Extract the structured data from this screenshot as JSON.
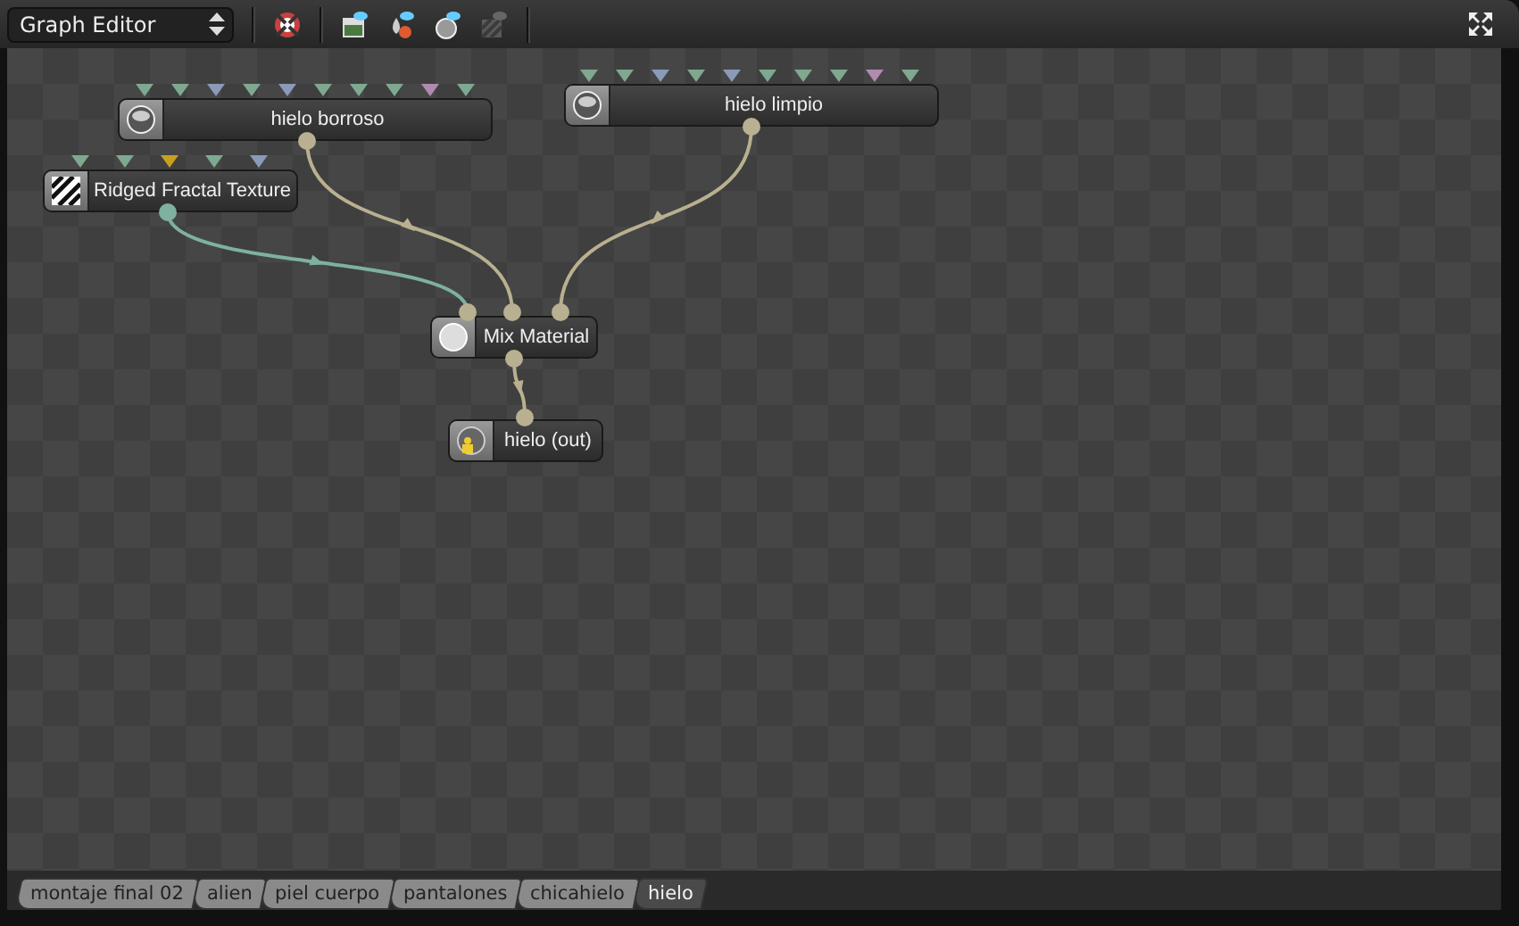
{
  "toolbar": {
    "editor_select": "Graph Editor"
  },
  "nodes": [
    {
      "title": "hielo borroso",
      "kind": "material",
      "inputs": [
        {
          "color": "#7fa890"
        },
        {
          "color": "#7fa890"
        },
        {
          "color": "#8a9ab8"
        },
        {
          "color": "#7fa890"
        },
        {
          "color": "#8a9ab8"
        },
        {
          "color": "#7fa890"
        },
        {
          "color": "#7fa890"
        },
        {
          "color": "#7fa890"
        },
        {
          "color": "#b08ab0"
        },
        {
          "color": "#7fa890"
        }
      ],
      "output": {
        "color": "#b8b090"
      }
    },
    {
      "title": "hielo limpio",
      "kind": "material",
      "inputs": [
        {
          "color": "#7fa890"
        },
        {
          "color": "#7fa890"
        },
        {
          "color": "#8a9ab8"
        },
        {
          "color": "#7fa890"
        },
        {
          "color": "#8a9ab8"
        },
        {
          "color": "#7fa890"
        },
        {
          "color": "#7fa890"
        },
        {
          "color": "#7fa890"
        },
        {
          "color": "#b08ab0"
        },
        {
          "color": "#7fa890"
        }
      ],
      "output": {
        "color": "#b8b090"
      }
    },
    {
      "title": "Ridged Fractal Texture",
      "kind": "texture",
      "inputs": [
        {
          "color": "#7fa890"
        },
        {
          "color": "#7fa890"
        },
        {
          "color": "#c8a020"
        },
        {
          "color": "#7fa890"
        },
        {
          "color": "#8a9ab8"
        }
      ],
      "output": {
        "color": "#7fb0a0"
      }
    },
    {
      "title": "Mix Material",
      "kind": "mix",
      "output": {
        "color": "#b8b090"
      }
    },
    {
      "title": "hielo (out)",
      "kind": "output"
    }
  ],
  "tabs": [
    {
      "label": "montaje final 02",
      "selected": false
    },
    {
      "label": "alien",
      "selected": false
    },
    {
      "label": "piel cuerpo",
      "selected": false
    },
    {
      "label": "pantalones",
      "selected": false
    },
    {
      "label": "chicahielo",
      "selected": false
    },
    {
      "label": "hielo",
      "selected": true
    }
  ]
}
